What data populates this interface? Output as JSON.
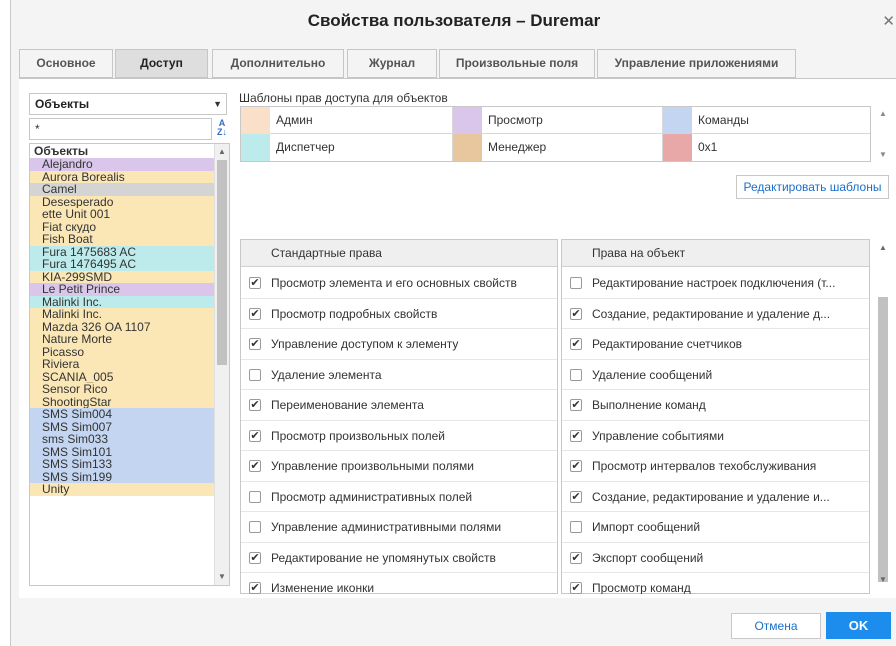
{
  "window": {
    "title": "Свойства пользователя – Duremar"
  },
  "tabs": [
    {
      "label": "Основное"
    },
    {
      "label": "Доступ"
    },
    {
      "label": "Дополнительно"
    },
    {
      "label": "Журнал"
    },
    {
      "label": "Произвольные поля"
    },
    {
      "label": "Управление приложениями"
    }
  ],
  "objects": {
    "selector_value": "Объекты",
    "search_value": "*",
    "list_header": "Объекты",
    "items": [
      {
        "label": "Alejandro",
        "color": "#d9c6ea"
      },
      {
        "label": "Aurora Borealis",
        "color": "#fbe7b6"
      },
      {
        "label": "Camel",
        "color": "#d4d4d4"
      },
      {
        "label": "Desesperado",
        "color": "#fbe7b6"
      },
      {
        "label": "ette Unit 001",
        "color": "#fbe7b6"
      },
      {
        "label": "Fiat скудо",
        "color": "#fbe7b6"
      },
      {
        "label": "Fish Boat",
        "color": "#fbe7b6"
      },
      {
        "label": "Fura 1475683 AC",
        "color": "#bdebec"
      },
      {
        "label": "Fura 1476495 AC",
        "color": "#bdebec"
      },
      {
        "label": "KIA-299SMD",
        "color": "#fbe7b6"
      },
      {
        "label": "Le Petit Prince",
        "color": "#d9c6ea"
      },
      {
        "label": "Malinki Inc.",
        "color": "#bdebec"
      },
      {
        "label": "Malinki Inc.",
        "color": "#fbe7b6"
      },
      {
        "label": "Mazda 326 OA 1107",
        "color": "#fbe7b6"
      },
      {
        "label": "Nature Morte",
        "color": "#fbe7b6"
      },
      {
        "label": "Picasso",
        "color": "#fbe7b6"
      },
      {
        "label": "Riviera",
        "color": "#fbe7b6"
      },
      {
        "label": "SCANIA_005",
        "color": "#fbe7b6"
      },
      {
        "label": "Sensor Rico",
        "color": "#fbe7b6"
      },
      {
        "label": "ShootingStar",
        "color": "#fbe7b6"
      },
      {
        "label": "SMS Sim004",
        "color": "#c3d5f0"
      },
      {
        "label": "SMS Sim007",
        "color": "#c3d5f0"
      },
      {
        "label": "sms Sim033",
        "color": "#c3d5f0"
      },
      {
        "label": "SMS Sim101",
        "color": "#c3d5f0"
      },
      {
        "label": "SMS Sim133",
        "color": "#c3d5f0"
      },
      {
        "label": "SMS Sim199",
        "color": "#c3d5f0"
      },
      {
        "label": "Unity",
        "color": "#fbe7b6"
      }
    ]
  },
  "templates": {
    "caption": "Шаблоны прав доступа для объектов",
    "items": [
      {
        "label": "Админ",
        "color": "#fbe0c9"
      },
      {
        "label": "Просмотр",
        "color": "#d9c6ea"
      },
      {
        "label": "Команды",
        "color": "#c3d5f0"
      },
      {
        "label": "Диспетчер",
        "color": "#bdebec"
      },
      {
        "label": "Менеджер",
        "color": "#e8c79e"
      },
      {
        "label": "0x1",
        "color": "#e8a8a8"
      }
    ],
    "edit_label": "Редактировать шаблоны"
  },
  "rights": {
    "standard_header": "Стандартные права",
    "object_header": "Права на объект",
    "standard": [
      {
        "label": "Просмотр элемента и его основных свойств",
        "checked": true
      },
      {
        "label": "Просмотр подробных свойств",
        "checked": true
      },
      {
        "label": "Управление доступом к элементу",
        "checked": true
      },
      {
        "label": "Удаление элемента",
        "checked": false
      },
      {
        "label": "Переименование элемента",
        "checked": true
      },
      {
        "label": "Просмотр произвольных полей",
        "checked": true
      },
      {
        "label": "Управление произвольными полями",
        "checked": true
      },
      {
        "label": "Просмотр административных полей",
        "checked": false
      },
      {
        "label": "Управление административными полями",
        "checked": false
      },
      {
        "label": "Редактирование не упомянутых свойств",
        "checked": true
      },
      {
        "label": "Изменение иконки",
        "checked": true
      }
    ],
    "object": [
      {
        "label": "Редактирование настроек подключения (т...",
        "checked": false
      },
      {
        "label": "Создание, редактирование и удаление д...",
        "checked": true
      },
      {
        "label": "Редактирование счетчиков",
        "checked": true
      },
      {
        "label": "Удаление сообщений",
        "checked": false
      },
      {
        "label": "Выполнение команд",
        "checked": true
      },
      {
        "label": "Управление событиями",
        "checked": true
      },
      {
        "label": "Просмотр интервалов техобслуживания",
        "checked": true
      },
      {
        "label": "Создание, редактирование и удаление и...",
        "checked": true
      },
      {
        "label": "Импорт сообщений",
        "checked": false
      },
      {
        "label": "Экспорт сообщений",
        "checked": true
      },
      {
        "label": "Просмотр команд",
        "checked": true
      }
    ]
  },
  "buttons": {
    "cancel": "Отмена",
    "ok": "OK"
  }
}
